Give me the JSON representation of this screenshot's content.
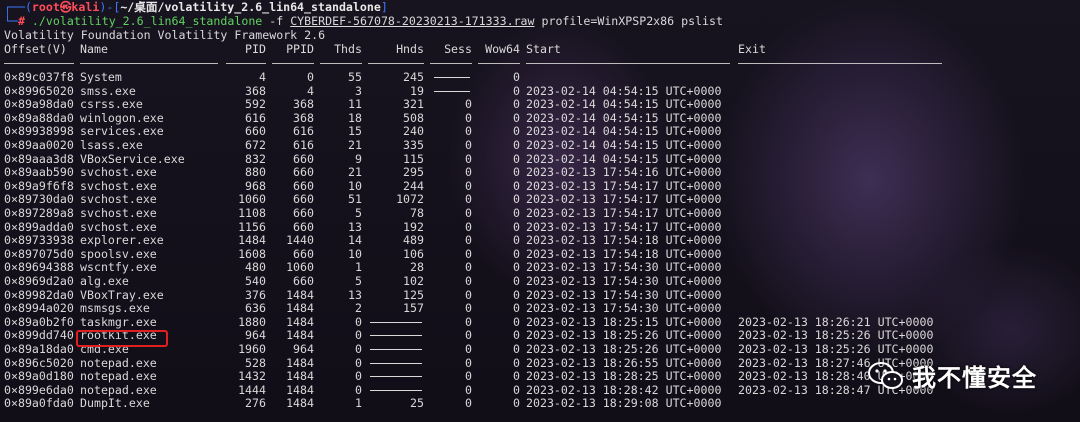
{
  "prompt": {
    "line1_open": "┌──(",
    "user": "root㉿kali",
    "line1_mid": ")-[",
    "path": "~/桌面/volatility_2.6_lin64_standalone",
    "line1_close": "]",
    "line2_prefix": "└─",
    "hash": "#",
    "command": " ./volatility_2.6_lin64_standalone",
    "flag": " -f ",
    "file": "CYBERDEF-567078-20230213-171333.raw",
    "args": " profile=WinXPSP2x86 pslist"
  },
  "banner": "Volatility Foundation Volatility Framework 2.6",
  "headers": {
    "offset": "Offset(V)",
    "name": "Name",
    "pid": "PID",
    "ppid": "PPID",
    "thds": "Thds",
    "hnds": "Hnds",
    "sess": "Sess",
    "wow64": "Wow64",
    "start": "Start",
    "exit": "Exit"
  },
  "processes": [
    {
      "offset": "0×89c037f8",
      "name": "System",
      "pid": "4",
      "ppid": "0",
      "thds": "55",
      "hnds": "245",
      "sess": "",
      "wow64": "0",
      "start": "",
      "exit": ""
    },
    {
      "offset": "0×89965020",
      "name": "smss.exe",
      "pid": "368",
      "ppid": "4",
      "thds": "3",
      "hnds": "19",
      "sess": "",
      "wow64": "0",
      "start": "2023-02-14 04:54:15 UTC+0000",
      "exit": ""
    },
    {
      "offset": "0×89a98da0",
      "name": "csrss.exe",
      "pid": "592",
      "ppid": "368",
      "thds": "11",
      "hnds": "321",
      "sess": "0",
      "wow64": "0",
      "start": "2023-02-14 04:54:15 UTC+0000",
      "exit": ""
    },
    {
      "offset": "0×89a88da0",
      "name": "winlogon.exe",
      "pid": "616",
      "ppid": "368",
      "thds": "18",
      "hnds": "508",
      "sess": "0",
      "wow64": "0",
      "start": "2023-02-14 04:54:15 UTC+0000",
      "exit": ""
    },
    {
      "offset": "0×89938998",
      "name": "services.exe",
      "pid": "660",
      "ppid": "616",
      "thds": "15",
      "hnds": "240",
      "sess": "0",
      "wow64": "0",
      "start": "2023-02-14 04:54:15 UTC+0000",
      "exit": ""
    },
    {
      "offset": "0×89aa0020",
      "name": "lsass.exe",
      "pid": "672",
      "ppid": "616",
      "thds": "21",
      "hnds": "335",
      "sess": "0",
      "wow64": "0",
      "start": "2023-02-14 04:54:15 UTC+0000",
      "exit": ""
    },
    {
      "offset": "0×89aaa3d8",
      "name": "VBoxService.exe",
      "pid": "832",
      "ppid": "660",
      "thds": "9",
      "hnds": "115",
      "sess": "0",
      "wow64": "0",
      "start": "2023-02-14 04:54:15 UTC+0000",
      "exit": ""
    },
    {
      "offset": "0×89aab590",
      "name": "svchost.exe",
      "pid": "880",
      "ppid": "660",
      "thds": "21",
      "hnds": "295",
      "sess": "0",
      "wow64": "0",
      "start": "2023-02-13 17:54:16 UTC+0000",
      "exit": ""
    },
    {
      "offset": "0×89a9f6f8",
      "name": "svchost.exe",
      "pid": "968",
      "ppid": "660",
      "thds": "10",
      "hnds": "244",
      "sess": "0",
      "wow64": "0",
      "start": "2023-02-13 17:54:17 UTC+0000",
      "exit": ""
    },
    {
      "offset": "0×89730da0",
      "name": "svchost.exe",
      "pid": "1060",
      "ppid": "660",
      "thds": "51",
      "hnds": "1072",
      "sess": "0",
      "wow64": "0",
      "start": "2023-02-13 17:54:17 UTC+0000",
      "exit": ""
    },
    {
      "offset": "0×897289a8",
      "name": "svchost.exe",
      "pid": "1108",
      "ppid": "660",
      "thds": "5",
      "hnds": "78",
      "sess": "0",
      "wow64": "0",
      "start": "2023-02-13 17:54:17 UTC+0000",
      "exit": ""
    },
    {
      "offset": "0×899adda0",
      "name": "svchost.exe",
      "pid": "1156",
      "ppid": "660",
      "thds": "13",
      "hnds": "192",
      "sess": "0",
      "wow64": "0",
      "start": "2023-02-13 17:54:17 UTC+0000",
      "exit": ""
    },
    {
      "offset": "0×89733938",
      "name": "explorer.exe",
      "pid": "1484",
      "ppid": "1440",
      "thds": "14",
      "hnds": "489",
      "sess": "0",
      "wow64": "0",
      "start": "2023-02-13 17:54:18 UTC+0000",
      "exit": ""
    },
    {
      "offset": "0×897075d0",
      "name": "spoolsv.exe",
      "pid": "1608",
      "ppid": "660",
      "thds": "10",
      "hnds": "106",
      "sess": "0",
      "wow64": "0",
      "start": "2023-02-13 17:54:18 UTC+0000",
      "exit": ""
    },
    {
      "offset": "0×89694388",
      "name": "wscntfy.exe",
      "pid": "480",
      "ppid": "1060",
      "thds": "1",
      "hnds": "28",
      "sess": "0",
      "wow64": "0",
      "start": "2023-02-13 17:54:30 UTC+0000",
      "exit": ""
    },
    {
      "offset": "0×8969d2a0",
      "name": "alg.exe",
      "pid": "540",
      "ppid": "660",
      "thds": "5",
      "hnds": "102",
      "sess": "0",
      "wow64": "0",
      "start": "2023-02-13 17:54:30 UTC+0000",
      "exit": ""
    },
    {
      "offset": "0×89982da0",
      "name": "VBoxTray.exe",
      "pid": "376",
      "ppid": "1484",
      "thds": "13",
      "hnds": "125",
      "sess": "0",
      "wow64": "0",
      "start": "2023-02-13 17:54:30 UTC+0000",
      "exit": ""
    },
    {
      "offset": "0×8994a020",
      "name": "msmsgs.exe",
      "pid": "636",
      "ppid": "1484",
      "thds": "2",
      "hnds": "157",
      "sess": "0",
      "wow64": "0",
      "start": "2023-02-13 17:54:30 UTC+0000",
      "exit": ""
    },
    {
      "offset": "0×89a0b2f0",
      "name": "taskmgr.exe",
      "pid": "1880",
      "ppid": "1484",
      "thds": "0",
      "hnds": "",
      "sess": "0",
      "wow64": "0",
      "start": "2023-02-13 18:25:15 UTC+0000",
      "exit": "2023-02-13 18:26:21 UTC+0000"
    },
    {
      "offset": "0×899dd740",
      "name": "rootkit.exe",
      "pid": "964",
      "ppid": "1484",
      "thds": "0",
      "hnds": "",
      "sess": "0",
      "wow64": "0",
      "start": "2023-02-13 18:25:26 UTC+0000",
      "exit": "2023-02-13 18:25:26 UTC+0000"
    },
    {
      "offset": "0×89a18da0",
      "name": "cmd.exe",
      "pid": "1960",
      "ppid": "964",
      "thds": "0",
      "hnds": "",
      "sess": "0",
      "wow64": "0",
      "start": "2023-02-13 18:25:26 UTC+0000",
      "exit": "2023-02-13 18:25:26 UTC+0000"
    },
    {
      "offset": "0×896c5020",
      "name": "notepad.exe",
      "pid": "528",
      "ppid": "1484",
      "thds": "0",
      "hnds": "",
      "sess": "0",
      "wow64": "0",
      "start": "2023-02-13 18:26:55 UTC+0000",
      "exit": "2023-02-13 18:27:46 UTC+0000"
    },
    {
      "offset": "0×89a0d180",
      "name": "notepad.exe",
      "pid": "1432",
      "ppid": "1484",
      "thds": "0",
      "hnds": "",
      "sess": "0",
      "wow64": "0",
      "start": "2023-02-13 18:28:25 UTC+0000",
      "exit": "2023-02-13 18:28:40 UTC+0000"
    },
    {
      "offset": "0×899e6da0",
      "name": "notepad.exe",
      "pid": "1444",
      "ppid": "1484",
      "thds": "0",
      "hnds": "",
      "sess": "0",
      "wow64": "0",
      "start": "2023-02-13 18:28:42 UTC+0000",
      "exit": "2023-02-13 18:28:47 UTC+0000"
    },
    {
      "offset": "0×89a0fda0",
      "name": "DumpIt.exe",
      "pid": "276",
      "ppid": "1484",
      "thds": "1",
      "hnds": "25",
      "sess": "0",
      "wow64": "0",
      "start": "2023-02-13 18:29:08 UTC+0000",
      "exit": ""
    }
  ],
  "highlight": {
    "process": "rootkit.exe",
    "color": "#e02020"
  },
  "watermark": {
    "icon": "wechat-icon",
    "text": "我不懂安全"
  },
  "colors": {
    "prompt_blue": "#3b78ff",
    "prompt_red": "#ff4d5a",
    "command_green": "#5fd35f",
    "text": "#d9d9d9"
  }
}
